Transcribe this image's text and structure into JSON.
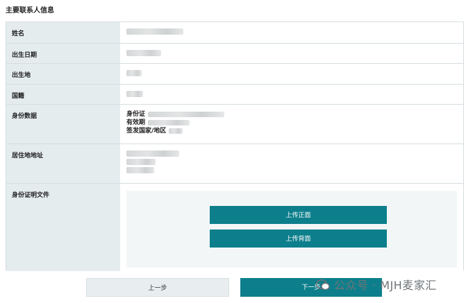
{
  "section": {
    "title": "主要联系人信息"
  },
  "rows": {
    "name": {
      "label": "姓名"
    },
    "birth_date": {
      "label": "出生日期"
    },
    "birth_place": {
      "label": "出生地"
    },
    "nationality": {
      "label": "国籍"
    },
    "id_data": {
      "label": "身份数据",
      "fields": [
        "身份证",
        "有效期",
        "签发国家/地区"
      ]
    },
    "address": {
      "label": "居住地地址"
    },
    "id_doc": {
      "label": "身份证明文件",
      "upload_front": "上传正面",
      "upload_back": "上传背面"
    }
  },
  "nav": {
    "prev": "上一步",
    "next": "下一步"
  },
  "watermark": {
    "text": "公众号 · MJH麦家汇",
    "icon": "wechat-icon"
  },
  "colors": {
    "accent": "#0d7f8c",
    "label_bg": "#e4ecee",
    "upload_bg": "#f3f6f7"
  }
}
